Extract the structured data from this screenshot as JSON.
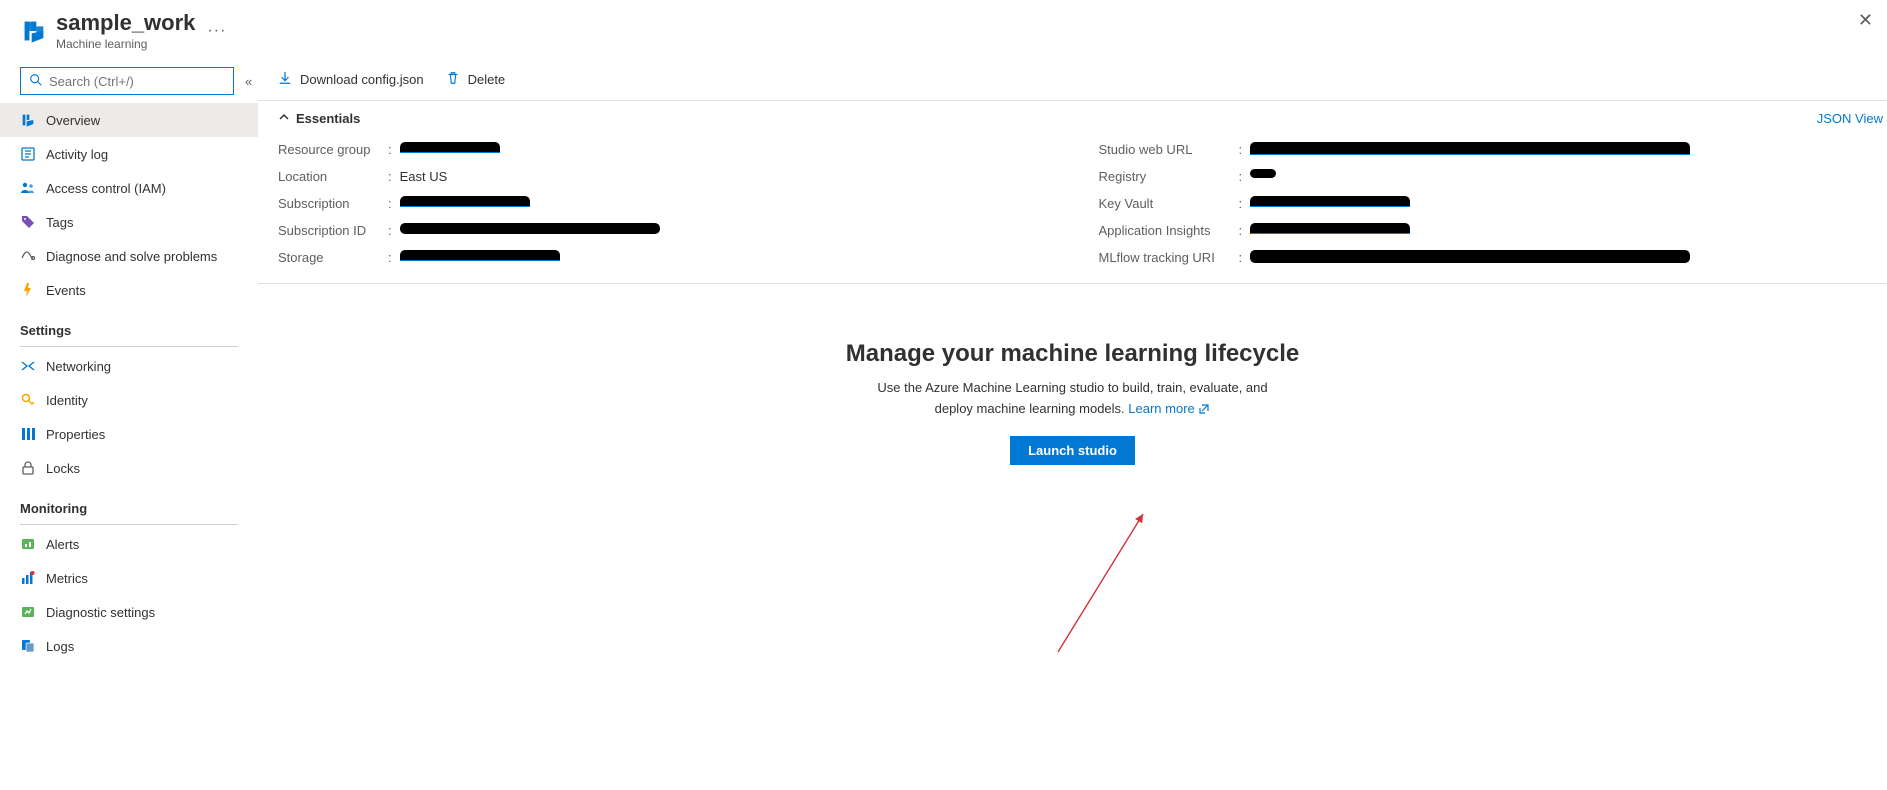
{
  "header": {
    "title": "sample_work",
    "subtitle": "Machine learning",
    "more": "···",
    "close": "✕"
  },
  "search": {
    "placeholder": "Search (Ctrl+/)",
    "collapse_glyph": "«"
  },
  "nav": {
    "items": [
      {
        "label": "Overview",
        "icon": "overview-icon",
        "active": true
      },
      {
        "label": "Activity log",
        "icon": "activity-log-icon"
      },
      {
        "label": "Access control (IAM)",
        "icon": "access-control-icon"
      },
      {
        "label": "Tags",
        "icon": "tags-icon"
      },
      {
        "label": "Diagnose and solve problems",
        "icon": "diagnose-icon"
      },
      {
        "label": "Events",
        "icon": "events-icon"
      }
    ],
    "settings_heading": "Settings",
    "settings_items": [
      {
        "label": "Networking",
        "icon": "networking-icon"
      },
      {
        "label": "Identity",
        "icon": "identity-icon"
      },
      {
        "label": "Properties",
        "icon": "properties-icon"
      },
      {
        "label": "Locks",
        "icon": "locks-icon"
      }
    ],
    "monitoring_heading": "Monitoring",
    "monitoring_items": [
      {
        "label": "Alerts",
        "icon": "alerts-icon"
      },
      {
        "label": "Metrics",
        "icon": "metrics-icon"
      },
      {
        "label": "Diagnostic settings",
        "icon": "diagnostic-settings-icon"
      },
      {
        "label": "Logs",
        "icon": "logs-icon"
      }
    ]
  },
  "toolbar": {
    "download_label": "Download config.json",
    "delete_label": "Delete"
  },
  "essentials": {
    "heading": "Essentials",
    "json_view": "JSON View",
    "left": [
      {
        "label": "Resource group",
        "value_type": "redacted",
        "link": true,
        "size": "r-sm"
      },
      {
        "label": "Location",
        "value_type": "text",
        "value": "East US"
      },
      {
        "label": "Subscription",
        "value_type": "redacted",
        "link": true,
        "size": "r-md"
      },
      {
        "label": "Subscription ID",
        "value_type": "redacted",
        "link": false,
        "size": "r-xl"
      },
      {
        "label": "Storage",
        "value_type": "redacted",
        "link": true,
        "size": "r-lg"
      }
    ],
    "right": [
      {
        "label": "Studio web URL",
        "value_type": "redacted",
        "link": true,
        "size": "r-xxl"
      },
      {
        "label": "Registry",
        "value_type": "redacted",
        "link": false,
        "size": "r-tiny"
      },
      {
        "label": "Key Vault",
        "value_type": "redacted",
        "link": true,
        "size": "r-lg"
      },
      {
        "label": "Application Insights",
        "value_type": "redacted",
        "link": true,
        "size": "r-lg"
      },
      {
        "label": "MLflow tracking URI",
        "value_type": "redacted",
        "link": false,
        "size": "r-xxl"
      }
    ]
  },
  "hero": {
    "title": "Manage your machine learning lifecycle",
    "desc": "Use the Azure Machine Learning studio to build, train, evaluate, and deploy machine learning models. ",
    "learn_more": "Learn more",
    "button": "Launch studio"
  }
}
